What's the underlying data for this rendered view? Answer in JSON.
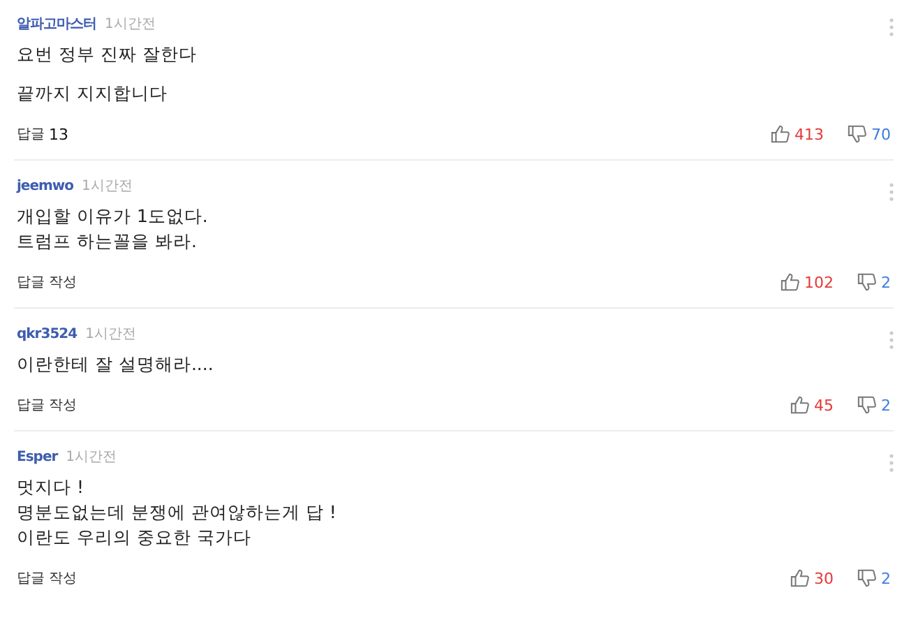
{
  "comments": [
    {
      "author": "알파고마스터",
      "time": "1시간전",
      "paragraphs": [
        [
          "요번 정부 진짜 잘한다"
        ],
        [
          "끝까지 지지합니다"
        ]
      ],
      "reply_label": "답글",
      "reply_count": "13",
      "likes": "413",
      "dislikes": "70"
    },
    {
      "author": "jeemwo",
      "time": "1시간전",
      "paragraphs": [
        [
          "개입할 이유가 1도없다.",
          "트럼프 하는꼴을 봐라."
        ]
      ],
      "reply_label": "답글 작성",
      "likes": "102",
      "dislikes": "2"
    },
    {
      "author": "qkr3524",
      "time": "1시간전",
      "paragraphs": [
        [
          "이란한테 잘 설명해라...."
        ]
      ],
      "reply_label": "답글 작성",
      "likes": "45",
      "dislikes": "2"
    },
    {
      "author": "Esper",
      "time": "1시간전",
      "paragraphs": [
        [
          "멋지다 !",
          "명분도없는데 분쟁에 관여않하는게 답 !",
          "이란도 우리의 중요한 국가다"
        ]
      ],
      "reply_label": "답글 작성",
      "likes": "30",
      "dislikes": "2"
    }
  ]
}
